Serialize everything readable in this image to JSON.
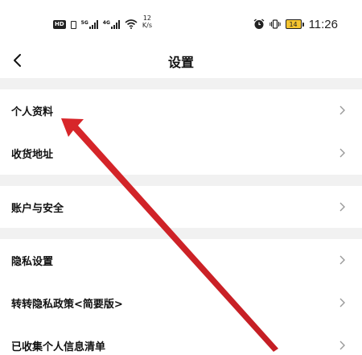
{
  "status_bar": {
    "hd_label": "HD",
    "signal1_label": "5G",
    "signal2_label": "4G",
    "speed_value": "12",
    "speed_unit": "K/s",
    "battery_level": "14",
    "time": "11:26"
  },
  "nav": {
    "back_icon": "chevron-left-icon",
    "title": "设置"
  },
  "settings": {
    "items": [
      {
        "label": "个人资料",
        "icon": "chevron-right-icon"
      },
      {
        "label": "收货地址",
        "icon": "chevron-right-icon"
      },
      {
        "label": "账户与安全",
        "icon": "chevron-right-icon"
      },
      {
        "label": "隐私设置",
        "icon": "chevron-right-icon"
      },
      {
        "label": "转转隐私政策<简要版>",
        "icon": "chevron-right-icon"
      },
      {
        "label": "已收集个人信息清单",
        "icon": "chevron-right-icon"
      }
    ]
  },
  "annotation": {
    "arrow_color": "#d8262a"
  }
}
